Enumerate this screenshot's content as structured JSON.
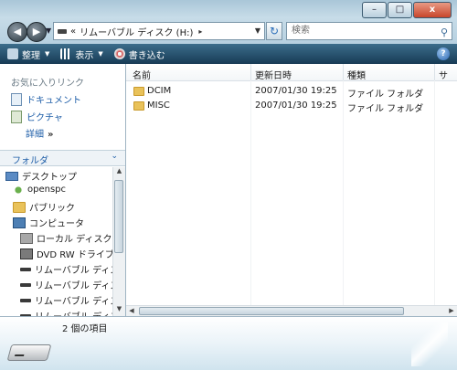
{
  "window": {
    "minimize_glyph": "–",
    "maximize_glyph": "□",
    "close_glyph": "x"
  },
  "nav": {
    "back_glyph": "◀",
    "forward_glyph": "▶",
    "history_glyph": "▼"
  },
  "address": {
    "chevron": "«",
    "path_segment": "リムーバブル ディスク (H:)",
    "arrow": "▸",
    "dropdown": "▼",
    "refresh_glyph": "↻"
  },
  "search": {
    "placeholder": "検索",
    "icon_glyph": "⚲"
  },
  "toolbar": {
    "organize_label": "整理",
    "view_label": "表示",
    "burn_label": "書き込む",
    "dropdown_glyph": "▼",
    "help_glyph": "?"
  },
  "favorites": {
    "title": "お気に入りリンク",
    "items": [
      "ドキュメント",
      "ピクチャ"
    ],
    "more_label": "詳細",
    "more_glyph": "»"
  },
  "folders": {
    "header_label": "フォルダ",
    "chevron": "⌄",
    "tree": [
      {
        "label": "デスクトップ",
        "icon": "desktop-icon"
      },
      {
        "label": "openspc",
        "icon": "user-icon"
      },
      {
        "label": "パブリック",
        "icon": "folder-icon"
      },
      {
        "label": "コンピュータ",
        "icon": "computer-icon"
      },
      {
        "label": "ローカル ディスク (C",
        "icon": "disk-icon"
      },
      {
        "label": "DVD RW ドライブ (I",
        "icon": "dvd-icon"
      },
      {
        "label": "リムーバブル ディスク",
        "icon": "drive-icon"
      },
      {
        "label": "リムーバブル ディスク",
        "icon": "drive-icon"
      },
      {
        "label": "リムーバブル ディスク",
        "icon": "drive-icon"
      },
      {
        "label": "リムーバブル ディスク",
        "icon": "drive-icon"
      }
    ]
  },
  "columns": {
    "name": "名前",
    "modified": "更新日時",
    "type": "種類",
    "size": "サ"
  },
  "files": [
    {
      "name": "DCIM",
      "modified": "2007/01/30 19:25",
      "type": "ファイル フォルダ"
    },
    {
      "name": "MISC",
      "modified": "2007/01/30 19:25",
      "type": "ファイル フォルダ"
    }
  ],
  "scroll": {
    "up_glyph": "▲",
    "down_glyph": "▼",
    "left_glyph": "◀",
    "right_glyph": "▶"
  },
  "status": {
    "item_count": "2 個の項目"
  }
}
